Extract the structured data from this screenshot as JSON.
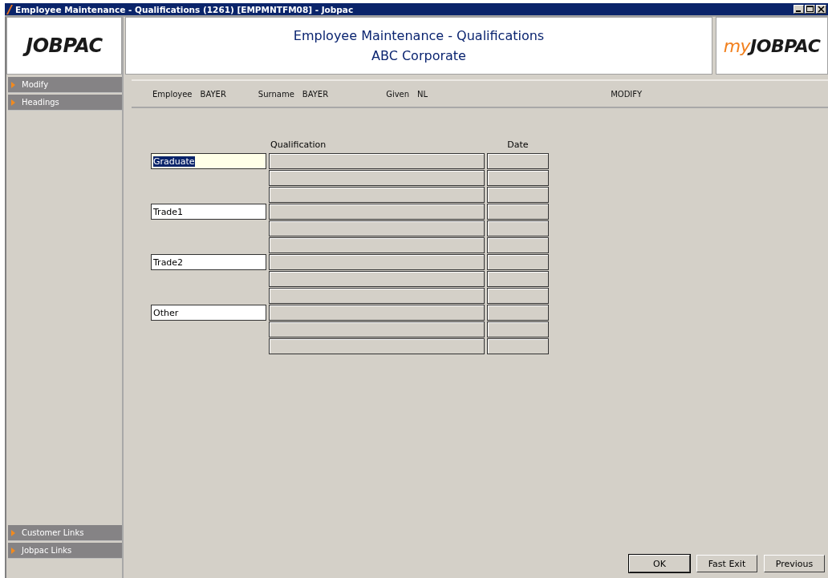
{
  "window": {
    "title": "Employee Maintenance - Qualifications (1261) [EMPMNTFM08] - Jobpac",
    "controls": [
      {
        "kind": "minimize"
      },
      {
        "kind": "maximize"
      },
      {
        "kind": "close"
      }
    ]
  },
  "header": {
    "logo": "JOBPAC",
    "title": "Employee Maintenance - Qualifications",
    "subtitle": "ABC Corporate",
    "logo_right_prefix": "my",
    "logo_right": "JOBPAC"
  },
  "sidebar": {
    "top_items": [
      {
        "label": "Modify"
      },
      {
        "label": "Headings"
      }
    ],
    "bottom_items": [
      {
        "label": "Customer Links"
      },
      {
        "label": "Jobpac Links"
      }
    ]
  },
  "info_bar": {
    "fields": [
      {
        "label": "Employee",
        "value": "BAYER"
      },
      {
        "label": "Surname",
        "value": "BAYER"
      },
      {
        "label": "Given",
        "value": "NL"
      }
    ],
    "mode": "MODIFY"
  },
  "table": {
    "columns": [
      "Qualification",
      "Date"
    ],
    "groups": [
      {
        "label": "Graduate",
        "focused": true,
        "rows": [
          {
            "kind": "entry"
          },
          {
            "kind": "entry"
          },
          {
            "kind": "entry"
          }
        ]
      },
      {
        "label": "Trade1",
        "focused": false,
        "rows": [
          {
            "kind": "entry"
          },
          {
            "kind": "entry"
          },
          {
            "kind": "entry"
          }
        ]
      },
      {
        "label": "Trade2",
        "focused": false,
        "rows": [
          {
            "kind": "entry"
          },
          {
            "kind": "entry"
          },
          {
            "kind": "entry"
          }
        ]
      },
      {
        "label": "Other",
        "focused": false,
        "rows": [
          {
            "kind": "entry"
          },
          {
            "kind": "entry"
          },
          {
            "kind": "entry"
          }
        ]
      }
    ]
  },
  "buttons": [
    {
      "label": "OK",
      "default": true
    },
    {
      "label": "Fast Exit",
      "default": false
    },
    {
      "label": "Previous",
      "default": false
    }
  ]
}
